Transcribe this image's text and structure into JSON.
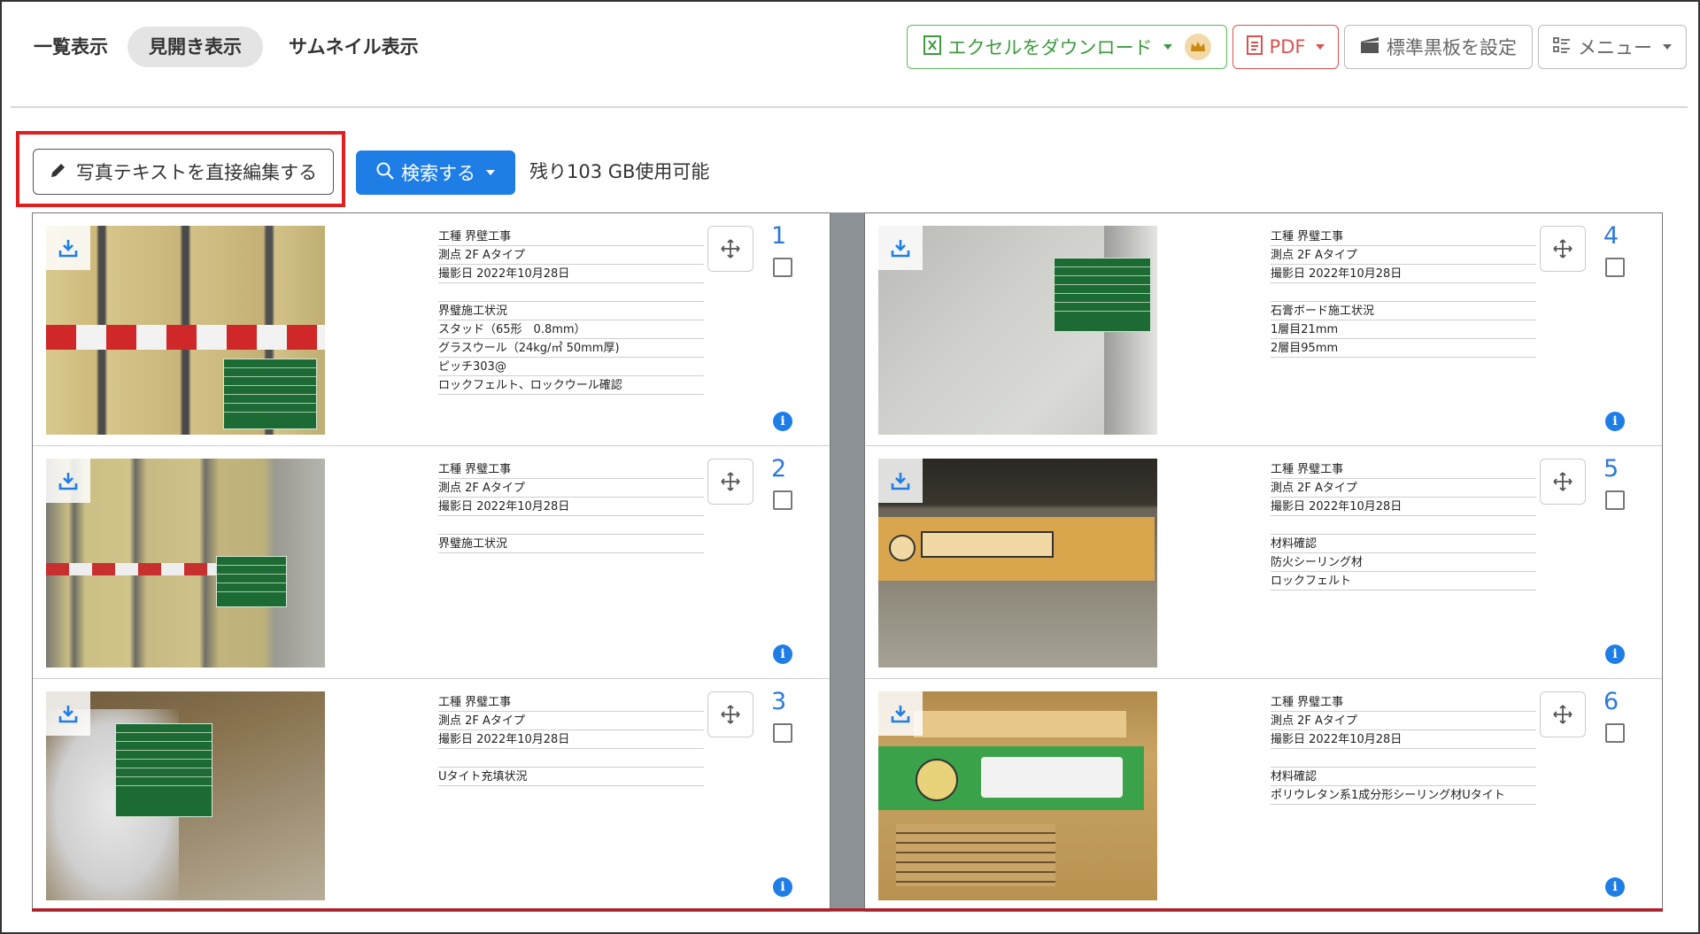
{
  "tabs": [
    {
      "label": "一覧表示",
      "active": false
    },
    {
      "label": "見開き表示",
      "active": true
    },
    {
      "label": "サムネイル表示",
      "active": false
    }
  ],
  "toolbar": {
    "excel_label": "エクセルをダウンロード",
    "pdf_label": "PDF",
    "board_label": "標準黒板を設定",
    "menu_label": "メニュー"
  },
  "actions": {
    "edit_label": "写真テキストを直接編集する",
    "search_label": "検索する",
    "storage_text": "残り103 GB使用可能"
  },
  "photos": [
    {
      "number": "1",
      "lines": [
        "工種 界壁工事",
        "測点 2F Aタイプ",
        "撮影日 2022年10月28日",
        "",
        "界璧施工状況",
        "スタッド（65形　0.8mm）",
        "グラスウール（24kg/㎥ 50mm厚)",
        "ピッチ303@",
        "ロックフェルト、ロックウール確認"
      ]
    },
    {
      "number": "2",
      "lines": [
        "工種 界璧工事",
        "測点 2F Aタイプ",
        "撮影日 2022年10月28日",
        "",
        "界璧施工状況"
      ]
    },
    {
      "number": "3",
      "lines": [
        "工種 界璧工事",
        "測点 2F Aタイプ",
        "撮影日 2022年10月28日",
        "",
        "Uタイト充填状況"
      ]
    },
    {
      "number": "4",
      "lines": [
        "工種 界璧工事",
        "測点 2F Aタイプ",
        "撮影日 2022年10月28日",
        "",
        "石膏ボード施工状況",
        "1層目21mm",
        "2層目95mm"
      ]
    },
    {
      "number": "5",
      "lines": [
        "工種 界璧工事",
        "測点 2F Aタイプ",
        "撮影日 2022年10月28日",
        "",
        "材料確認",
        "防火シーリング材",
        "ロックフェルト"
      ]
    },
    {
      "number": "6",
      "lines": [
        "工種 界璧工事",
        "測点 2F Aタイプ",
        "撮影日 2022年10月28日",
        "",
        "材料確認",
        "ポリウレタン系1成分形シーリング材Uタイト"
      ]
    }
  ],
  "colors": {
    "accent": "#1e7ee6",
    "excel": "#5cb85c",
    "pdf": "#d9534f",
    "highlight": "#e02020"
  }
}
